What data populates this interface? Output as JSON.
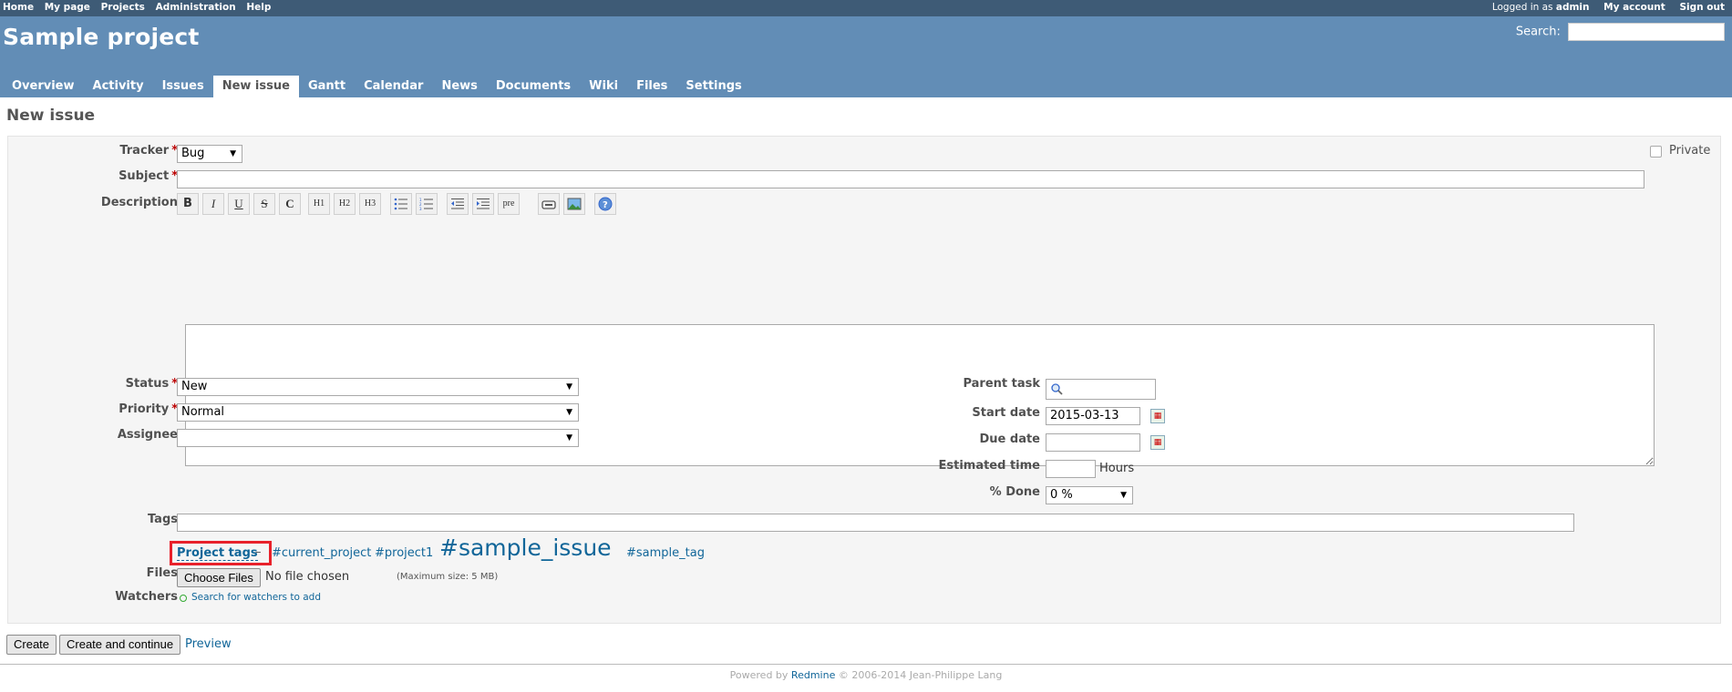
{
  "top_menu": {
    "left": [
      "Home",
      "My page",
      "Projects",
      "Administration",
      "Help"
    ],
    "logged_in_prefix": "Logged in as",
    "logged_in_user": "admin",
    "my_account": "My account",
    "sign_out": "Sign out"
  },
  "header": {
    "project_title": "Sample project",
    "search_label": "Search:",
    "search_value": ""
  },
  "main_menu": [
    {
      "label": "Overview",
      "selected": false
    },
    {
      "label": "Activity",
      "selected": false
    },
    {
      "label": "Issues",
      "selected": false
    },
    {
      "label": "New issue",
      "selected": true
    },
    {
      "label": "Gantt",
      "selected": false
    },
    {
      "label": "Calendar",
      "selected": false
    },
    {
      "label": "News",
      "selected": false
    },
    {
      "label": "Documents",
      "selected": false
    },
    {
      "label": "Wiki",
      "selected": false
    },
    {
      "label": "Files",
      "selected": false
    },
    {
      "label": "Settings",
      "selected": false
    }
  ],
  "page_title": "New issue",
  "form": {
    "tracker": {
      "label": "Tracker",
      "value": "Bug"
    },
    "private_label": "Private",
    "subject": {
      "label": "Subject",
      "value": ""
    },
    "description_label": "Description",
    "toolbar": [
      "B",
      "I",
      "U",
      "S",
      "C",
      "H1",
      "H2",
      "H3",
      "ul",
      "ol",
      "indent-left",
      "indent-right",
      "pre",
      "link",
      "image",
      "help"
    ],
    "status": {
      "label": "Status",
      "value": "New"
    },
    "priority": {
      "label": "Priority",
      "value": "Normal"
    },
    "assignee": {
      "label": "Assignee",
      "value": ""
    },
    "parent_task": {
      "label": "Parent task",
      "value": ""
    },
    "start_date": {
      "label": "Start date",
      "value": "2015-03-13"
    },
    "due_date": {
      "label": "Due date",
      "value": ""
    },
    "estimated_time": {
      "label": "Estimated time",
      "value": "",
      "unit": "Hours"
    },
    "done": {
      "label": "% Done",
      "value": "0 %"
    },
    "tags": {
      "label": "Tags",
      "value": ""
    },
    "project_tags_label": "Project tags",
    "project_tags_dash": "–",
    "tag_list": [
      "#current_project",
      "#project1",
      "#sample_issue",
      "#sample_tag"
    ],
    "files": {
      "label": "Files",
      "button": "Choose Files",
      "status": "No file chosen",
      "max_size": "(Maximum size: 5 MB)"
    },
    "watchers": {
      "label": "Watchers",
      "link": "Search for watchers to add"
    }
  },
  "actions": {
    "create": "Create",
    "create_continue": "Create and continue",
    "preview": "Preview"
  },
  "footer": {
    "prefix": "Powered by",
    "link": "Redmine",
    "suffix": "© 2006-2014 Jean-Philippe Lang"
  },
  "colors": {
    "top_menu": "#3E5B76",
    "header": "#628DB6",
    "link": "#116699",
    "highlight_box": "#e8212b"
  }
}
